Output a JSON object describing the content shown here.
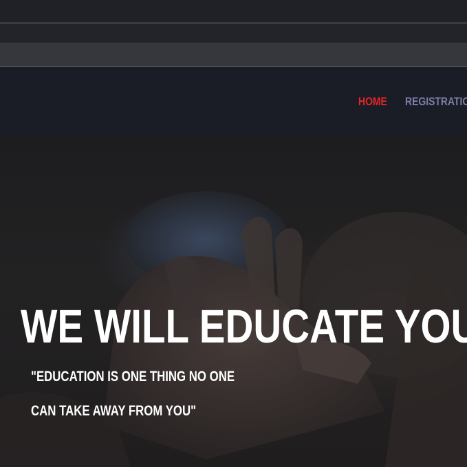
{
  "nav": {
    "items": [
      {
        "label": "HOME",
        "active": true
      },
      {
        "label": "REGISTRATIO",
        "active": false
      }
    ],
    "active_color": "#e5252a",
    "inactive_color": "#7b7fa8"
  },
  "hero": {
    "title": "WE WILL EDUCATE YOU",
    "quote_lines": [
      "\"EDUCATION IS ONE THING NO ONE",
      "CAN TAKE AWAY FROM YOU\""
    ],
    "background_image": "hands-holding-image"
  }
}
